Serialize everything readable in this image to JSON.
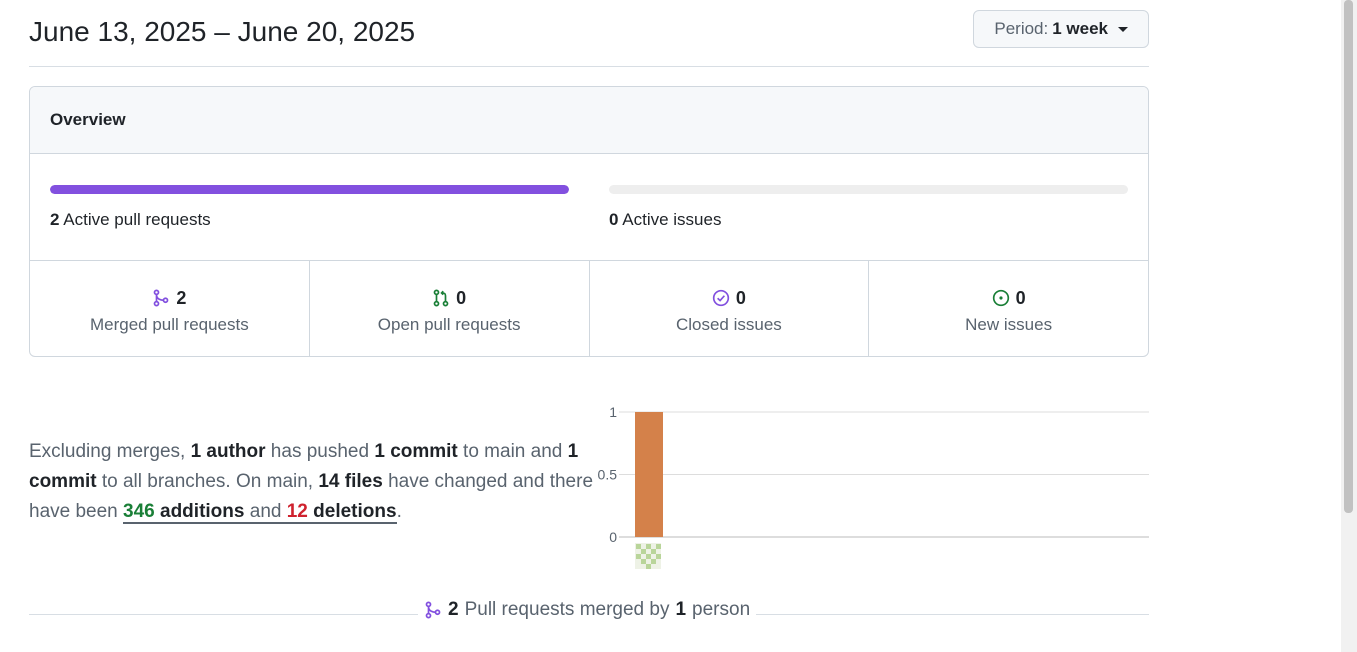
{
  "header": {
    "date_range": "June 13, 2025 – June 20, 2025",
    "period_label": "Period:",
    "period_value": "1 week"
  },
  "overview": {
    "title": "Overview",
    "active_prs": {
      "count": "2",
      "label": "Active pull requests",
      "fill_fraction": 1.0,
      "color": "#8250df"
    },
    "active_issues": {
      "count": "0",
      "label": "Active issues",
      "fill_fraction": 0.0
    },
    "stats": [
      {
        "count": "2",
        "label": "Merged pull requests",
        "icon": "merge-icon",
        "color": "#8250df"
      },
      {
        "count": "0",
        "label": "Open pull requests",
        "icon": "pull-request-icon",
        "color": "#1a7f37"
      },
      {
        "count": "0",
        "label": "Closed issues",
        "icon": "issue-closed-icon",
        "color": "#8250df"
      },
      {
        "count": "0",
        "label": "New issues",
        "icon": "issue-opened-icon",
        "color": "#1a7f37"
      }
    ]
  },
  "summary": {
    "p1": "Excluding merges, ",
    "authors": "1 author",
    "p2": " has pushed ",
    "commits_main": "1 commit",
    "p3": " to main and ",
    "commits_all": "1 commit",
    "p4": " to all branches. On main, ",
    "files": "14 files",
    "p5": " have changed and there have been ",
    "additions_num": "346",
    "additions_word": " additions",
    "and": " and ",
    "deletions_num": "12",
    "deletions_word": " deletions",
    "end": "."
  },
  "chart_data": {
    "type": "bar",
    "categories": [
      ""
    ],
    "values": [
      1
    ],
    "ylim": [
      0,
      1
    ],
    "yticks": [
      "1",
      "0.5",
      "0"
    ],
    "bar_color": "#d4814a",
    "grid": true
  },
  "merged_footer": {
    "count": "2",
    "text1": "Pull requests merged by",
    "people": "1",
    "text2": "person"
  }
}
